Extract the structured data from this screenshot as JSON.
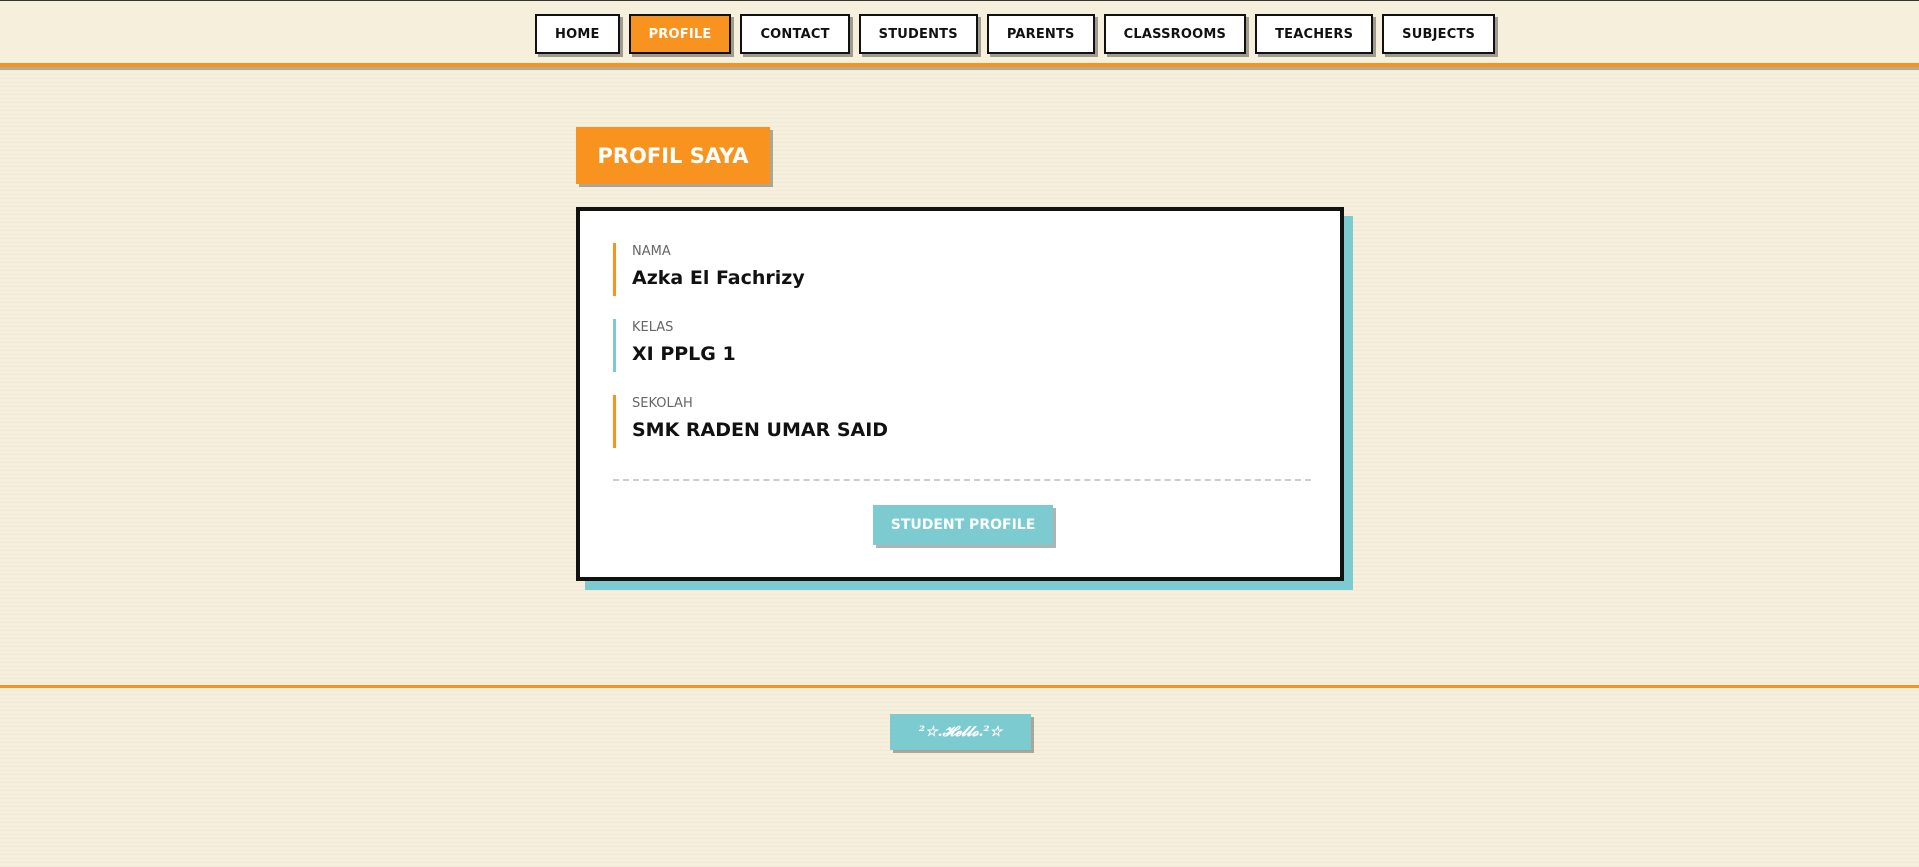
{
  "nav": {
    "items": [
      {
        "label": "HOME",
        "active": false
      },
      {
        "label": "PROFILE",
        "active": true
      },
      {
        "label": "CONTACT",
        "active": false
      },
      {
        "label": "STUDENTS",
        "active": false
      },
      {
        "label": "PARENTS",
        "active": false
      },
      {
        "label": "CLASSROOMS",
        "active": false
      },
      {
        "label": "TEACHERS",
        "active": false
      },
      {
        "label": "SUBJECTS",
        "active": false
      }
    ]
  },
  "page": {
    "title": "PROFIL SAYA"
  },
  "profile": {
    "fields": [
      {
        "label": "NAMA",
        "value": "Azka El Fachrizy"
      },
      {
        "label": "KELAS",
        "value": "XI PPLG 1"
      },
      {
        "label": "SEKOLAH",
        "value": "SMK RADEN UMAR SAID"
      }
    ],
    "button_label": "STUDENT PROFILE"
  },
  "footer": {
    "badge_text": "²☆.𝓗𝓮𝓵𝓵𝓸.²☆"
  },
  "colors": {
    "accent_orange": "#f7931e",
    "accent_teal": "#7ccbd0",
    "background": "#f5efdc"
  }
}
